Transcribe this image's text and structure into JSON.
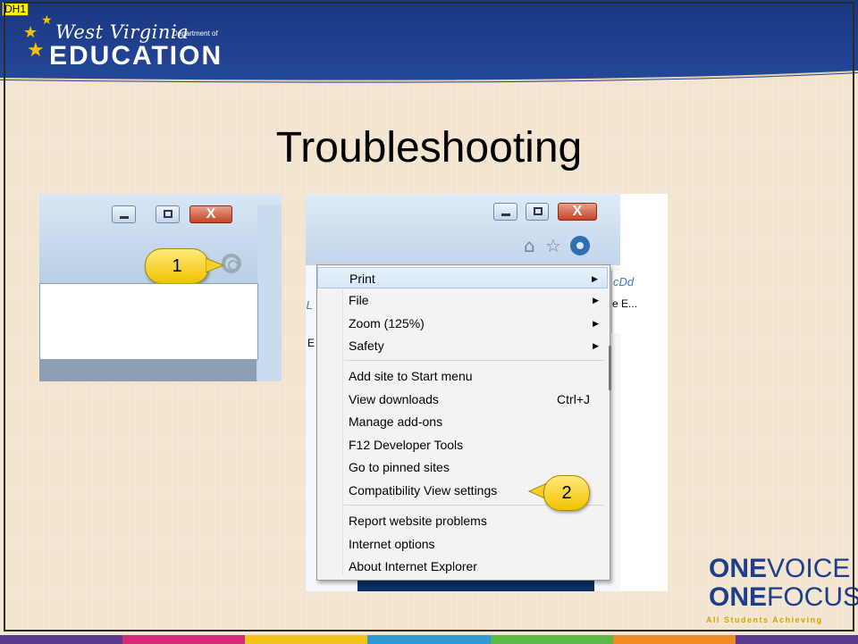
{
  "tag": "DH1",
  "logo": {
    "script_text": "West Virginia",
    "dept_text": "Department of",
    "main_text": "EDUCATION"
  },
  "title": "Troubleshooting",
  "shot1": {
    "close_label": "X",
    "callout": "1"
  },
  "shot2": {
    "close_label": "X",
    "callout": "2",
    "bg_text": [
      "cDd",
      "e E...",
      "cL",
      "e E"
    ],
    "menu": [
      {
        "label": "Print",
        "submenu": true
      },
      {
        "label": "File",
        "submenu": true
      },
      {
        "label": "Zoom (125%)",
        "submenu": true
      },
      {
        "label": "Safety",
        "submenu": true
      },
      {
        "label": "Add site to Start menu"
      },
      {
        "label": "View downloads",
        "shortcut": "Ctrl+J"
      },
      {
        "label": "Manage add-ons"
      },
      {
        "label": "F12 Developer Tools"
      },
      {
        "label": "Go to pinned sites"
      },
      {
        "label": "Compatibility View settings"
      },
      {
        "label": "Report website problems"
      },
      {
        "label": "Internet options"
      },
      {
        "label": "About Internet Explorer"
      }
    ]
  },
  "brand": {
    "one1": "ONE",
    "voice": "VOICE",
    "one2": "ONE",
    "focus": "FOCUS",
    "tagline": "All Students Achieving"
  },
  "icons": [
    "star-icon",
    "gear-icon",
    "home-icon",
    "favorites-star-icon",
    "minimize-icon",
    "maximize-icon",
    "close-icon"
  ],
  "colors": {
    "slide_bg": "#f2e4cf",
    "header_blue": "#1d3e8a",
    "logo_star": "#f5c400",
    "callout_yellow": "#f7d33a",
    "ovof_blue": "#1d3e8a",
    "ovof_gold": "#d8a000",
    "bar": [
      "#5a3a8e",
      "#d7287a",
      "#f0c419",
      "#2e9ad6",
      "#5cb848",
      "#f08a24",
      "#5a3a8e"
    ]
  }
}
